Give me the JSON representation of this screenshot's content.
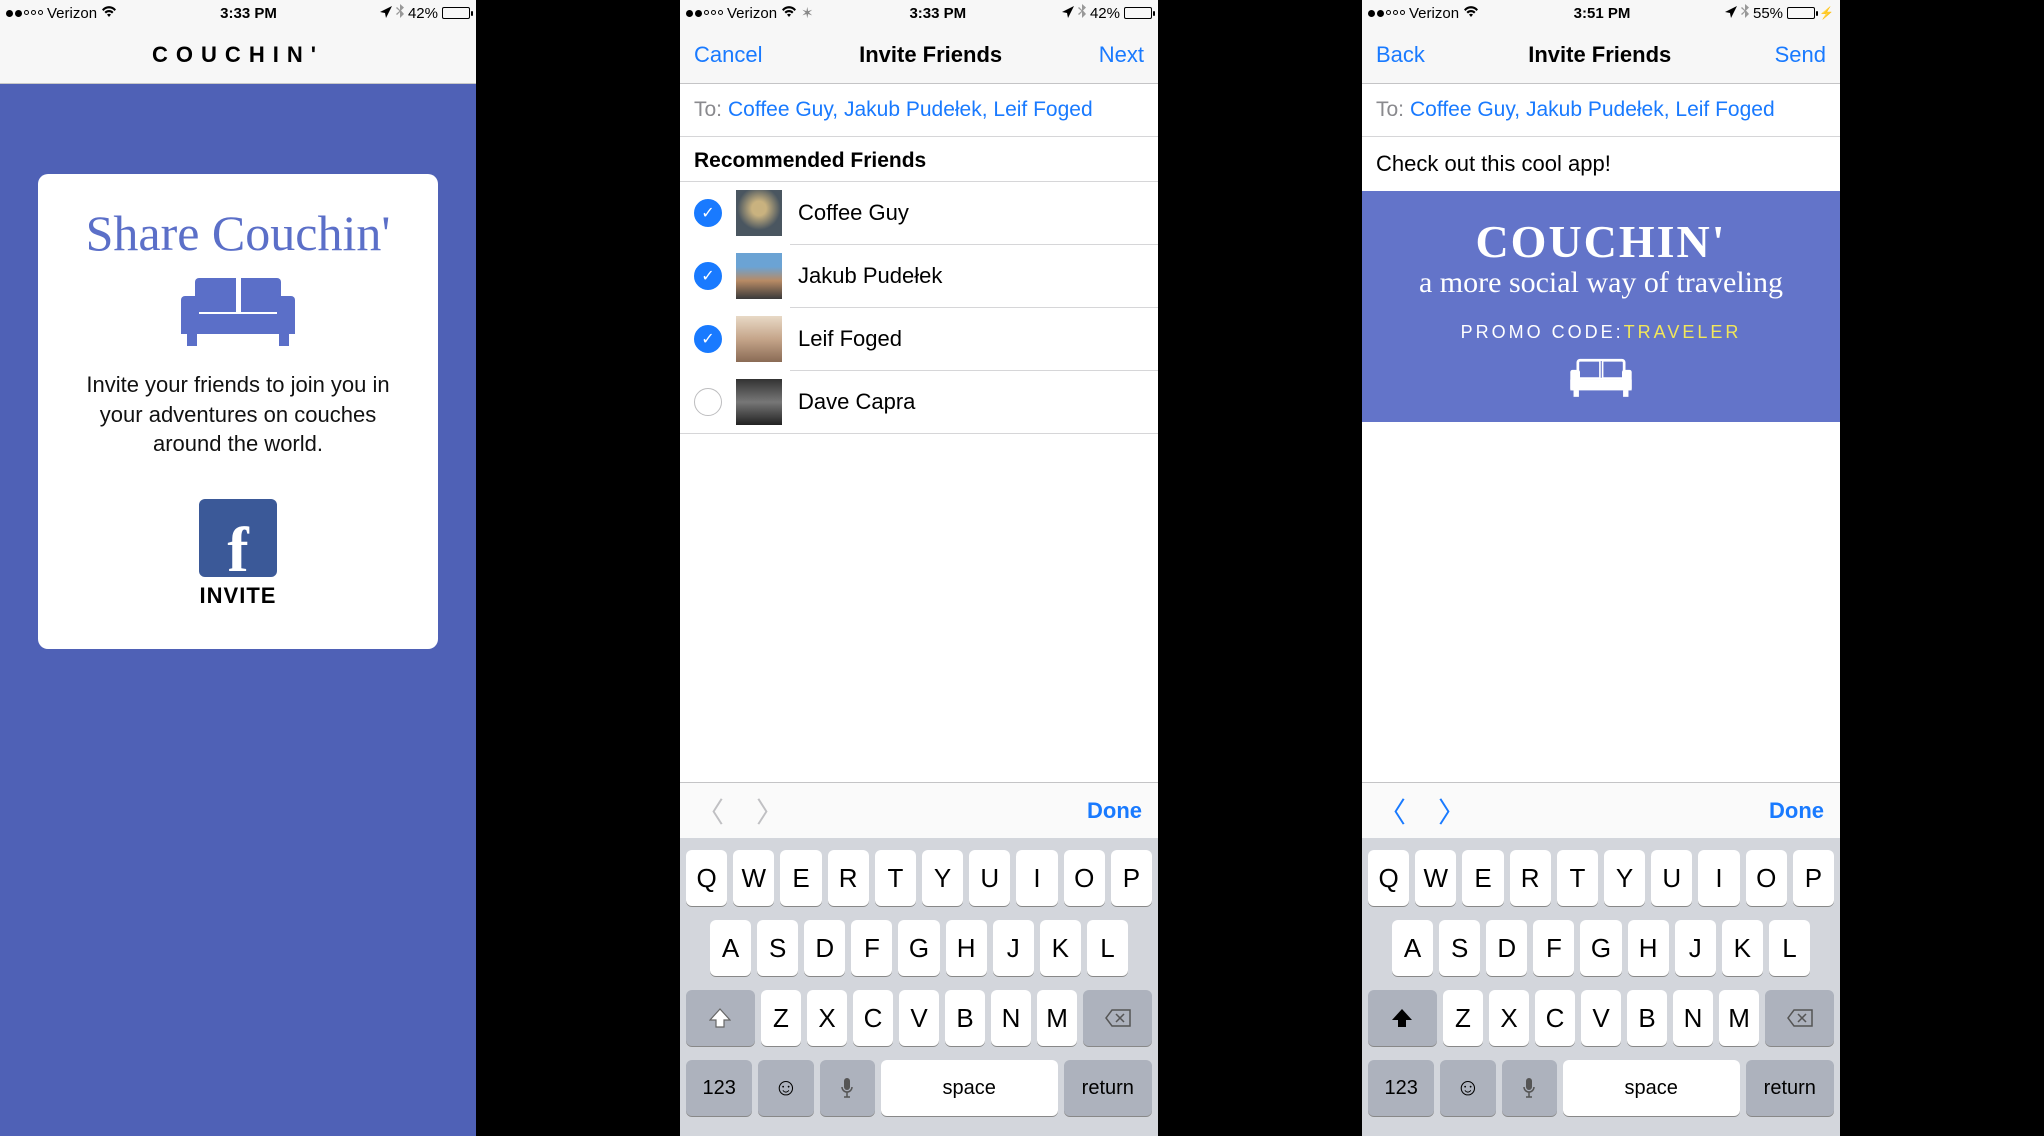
{
  "statusbar": {
    "carrier": "Verizon",
    "time1": "3:33 PM",
    "time2": "3:33 PM",
    "time3": "3:51 PM",
    "battery1": "42%",
    "battery2": "42%",
    "battery3": "55%"
  },
  "screen1": {
    "app_title": "COUCHIN'",
    "share_title": "Share Couchin'",
    "description": "Invite your friends to join you in your adventures on couches around the world.",
    "invite_label": "INVITE"
  },
  "screen2": {
    "nav_left": "Cancel",
    "nav_title": "Invite Friends",
    "nav_right": "Next",
    "to_label": "To:",
    "to_names": "Coffee Guy, Jakub Pudełek, Leif Foged",
    "section_header": "Recommended Friends",
    "friends": [
      {
        "name": "Coffee Guy",
        "checked": true
      },
      {
        "name": "Jakub Pudełek",
        "checked": true
      },
      {
        "name": "Leif Foged",
        "checked": true
      },
      {
        "name": "Dave Capra",
        "checked": false
      }
    ],
    "accessory_done": "Done"
  },
  "screen3": {
    "nav_left": "Back",
    "nav_title": "Invite Friends",
    "nav_right": "Send",
    "to_label": "To:",
    "to_names": "Coffee Guy, Jakub Pudełek, Leif Foged",
    "message_text": "Check out this cool app!",
    "promo_title": "COUCHIN'",
    "promo_sub": "a more social way of traveling",
    "promo_code_label": "PROMO CODE:",
    "promo_code": "TRAVELER",
    "accessory_done": "Done"
  },
  "keyboard": {
    "row1": [
      "Q",
      "W",
      "E",
      "R",
      "T",
      "Y",
      "U",
      "I",
      "O",
      "P"
    ],
    "row2": [
      "A",
      "S",
      "D",
      "F",
      "G",
      "H",
      "J",
      "K",
      "L"
    ],
    "row3": [
      "Z",
      "X",
      "C",
      "V",
      "B",
      "N",
      "M"
    ],
    "num": "123",
    "space": "space",
    "return": "return"
  }
}
